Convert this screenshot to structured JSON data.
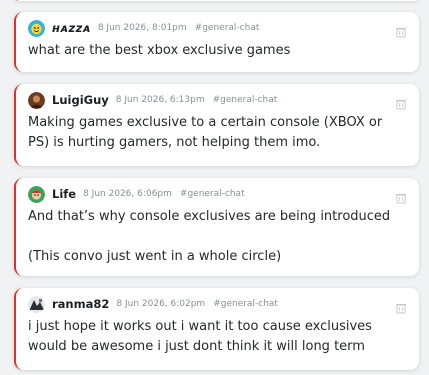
{
  "messages": [
    {
      "username": "ʜᴀzzᴀ",
      "timestamp": "8 Jun 2026, 8:01pm",
      "channel": "#general-chat",
      "text": "what are the best xbox exclusive games",
      "avatar": "cyan-smiley-avatar"
    },
    {
      "username": "LuigiGuy",
      "timestamp": "8 Jun 2026, 6:13pm",
      "channel": "#general-chat",
      "text": "Making games exclusive to a certain console (XBOX or PS) is hurting gamers, not helping them imo.",
      "avatar": "brown-photo-avatar"
    },
    {
      "username": "Life",
      "timestamp": "8 Jun 2026, 6:06pm",
      "channel": "#general-chat",
      "text": "And that’s why console exclusives are being introduced\n\n(This convo just went in a whole circle)",
      "avatar": "green-cartoon-avatar"
    },
    {
      "username": "ranma82",
      "timestamp": "8 Jun 2026, 6:02pm",
      "channel": "#general-chat",
      "text": "i just hope it works out i want it too cause exclusives would be awesome i just dont think it will long term",
      "avatar": "dark-photo-avatar"
    }
  ],
  "colors": {
    "accent_border": "#d9342b",
    "background": "#f1f2f4",
    "card": "#ffffff",
    "meta_text": "#8a8f98"
  },
  "icons": {
    "delete": "trash-icon"
  }
}
